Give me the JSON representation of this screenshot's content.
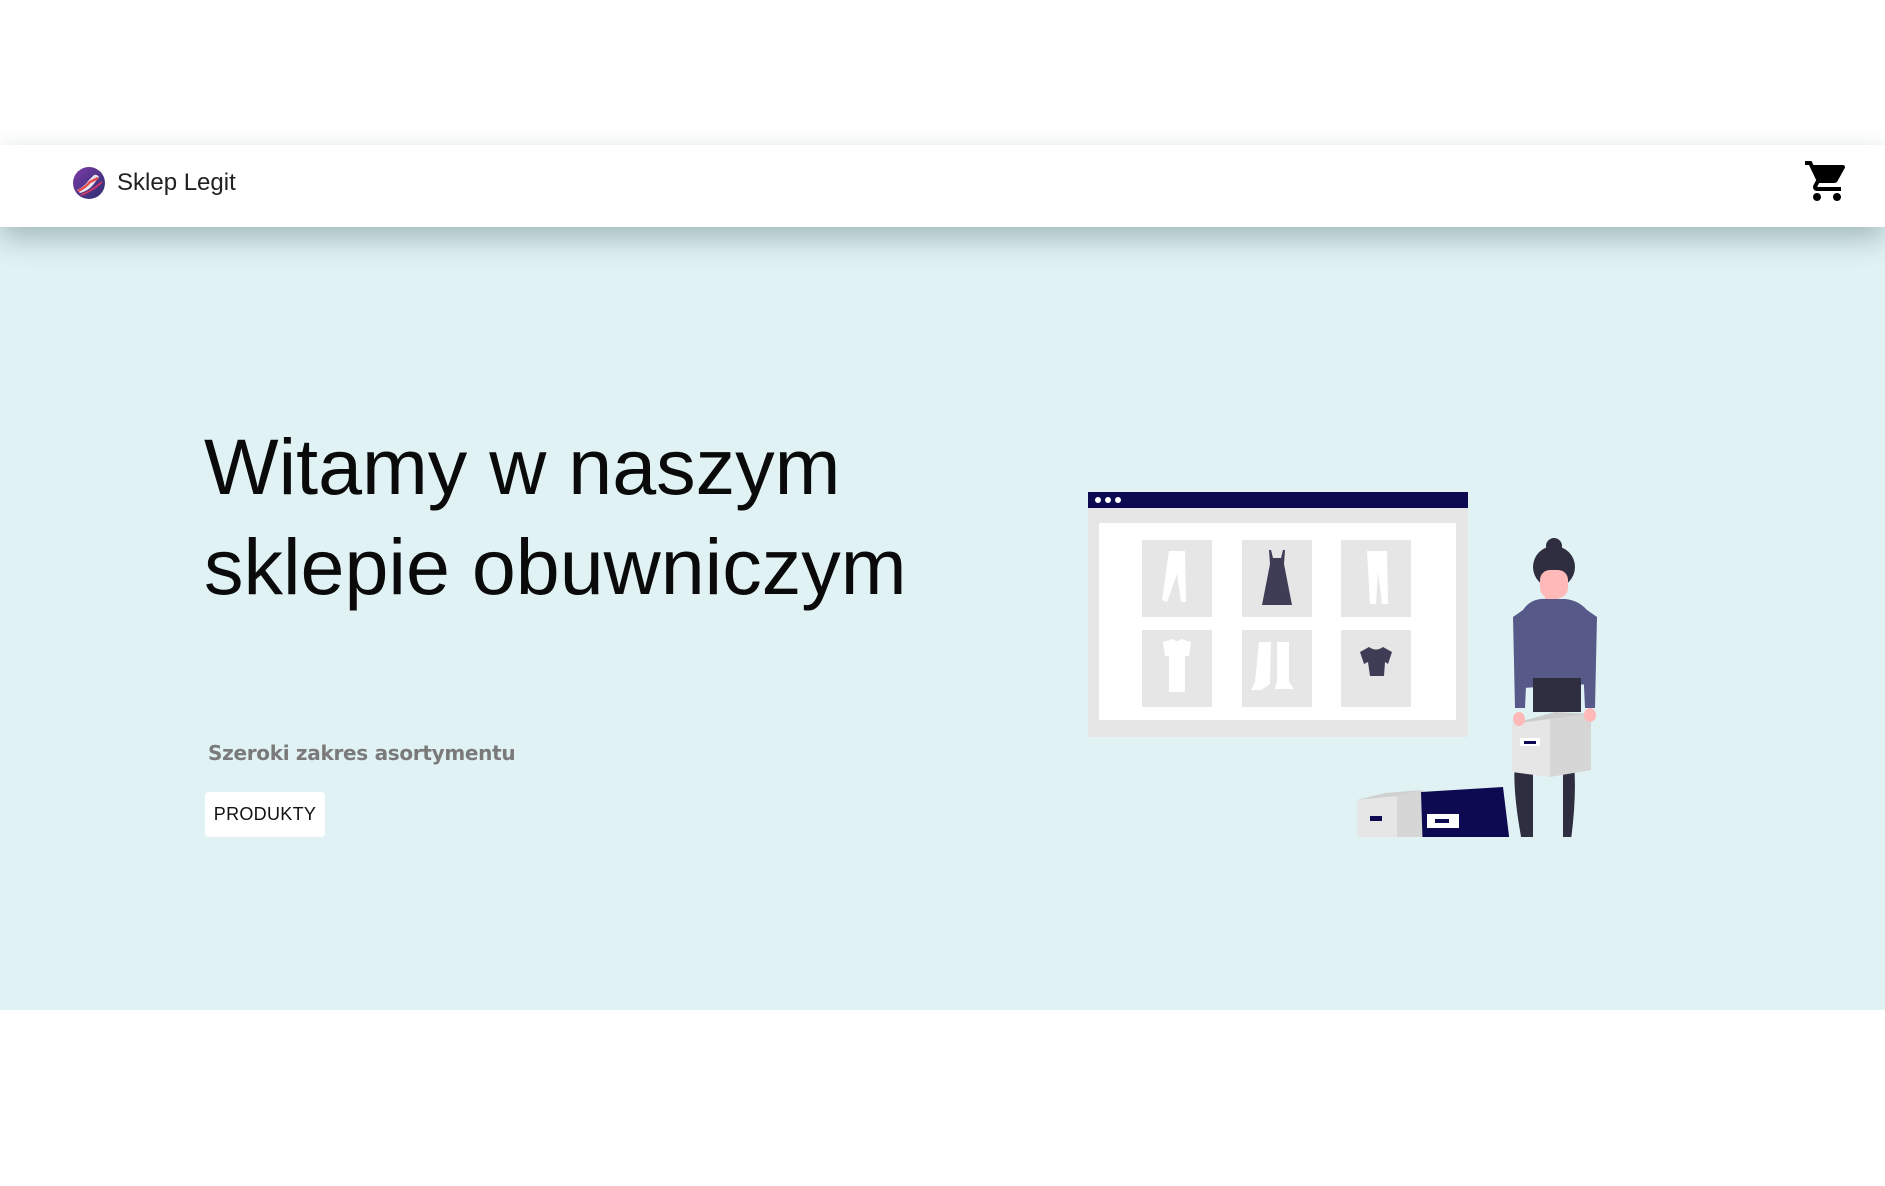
{
  "navbar": {
    "brand_name": "Sklep Legit",
    "brand_logo_icon": "shoe-logo-icon",
    "cart_icon": "shopping-cart-icon"
  },
  "hero": {
    "title": "Witamy w naszym sklepie obuwniczym",
    "subtitle": "Szeroki zakres asortymentu",
    "button_label": "PRODUKTY",
    "illustration": "online-shop-woman-with-boxes-illustration"
  },
  "colors": {
    "hero_background": "#e1f2f4",
    "navy_accent": "#0d0a52",
    "figure_purple": "#575a89",
    "dark_item": "#3f3d56"
  }
}
